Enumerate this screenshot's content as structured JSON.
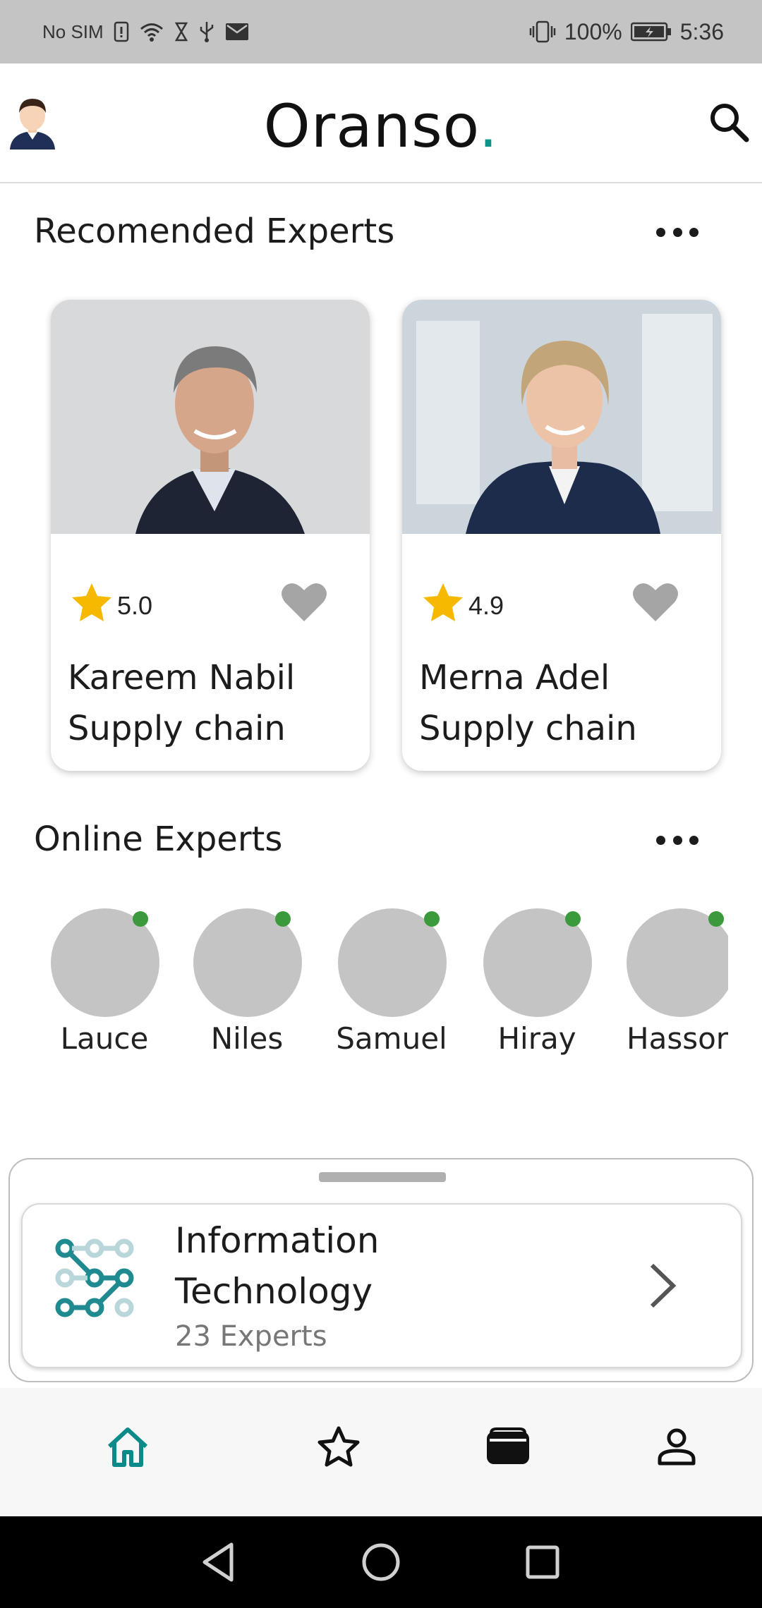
{
  "status_bar": {
    "carrier": "No SIM",
    "battery": "100%",
    "time": "5:36"
  },
  "header": {
    "brand": "Oranso",
    "brand_dot": ".",
    "brand_dot_color": "#0b9488",
    "avatar_icon": "user-avatar-icon",
    "search_icon": "search-icon"
  },
  "recommended": {
    "title": "Recomended Experts",
    "more_icon": "more-horizontal-icon",
    "experts": [
      {
        "rating": "5.0",
        "name": "Kareem Nabil",
        "field": "Supply chain"
      },
      {
        "rating": "4.9",
        "name": "Merna Adel",
        "field": "Supply chain"
      }
    ]
  },
  "online": {
    "title": "Online Experts",
    "more_icon": "more-horizontal-icon",
    "status_color": "#3a9a3c",
    "experts": [
      {
        "name": "Lauce"
      },
      {
        "name": "Niles"
      },
      {
        "name": "Samuel"
      },
      {
        "name": "Hiray"
      },
      {
        "name": "Hassor"
      }
    ]
  },
  "category_sheet": {
    "title_line1": "Information",
    "title_line2": "Technology",
    "count": "23 Experts",
    "icon": "network-nodes-icon"
  },
  "bottom_nav": {
    "active_color": "#0b8a8a",
    "items": [
      {
        "icon": "home-icon",
        "active": true
      },
      {
        "icon": "star-icon",
        "active": false
      },
      {
        "icon": "wallet-icon",
        "active": false
      },
      {
        "icon": "profile-icon",
        "active": false
      }
    ]
  }
}
